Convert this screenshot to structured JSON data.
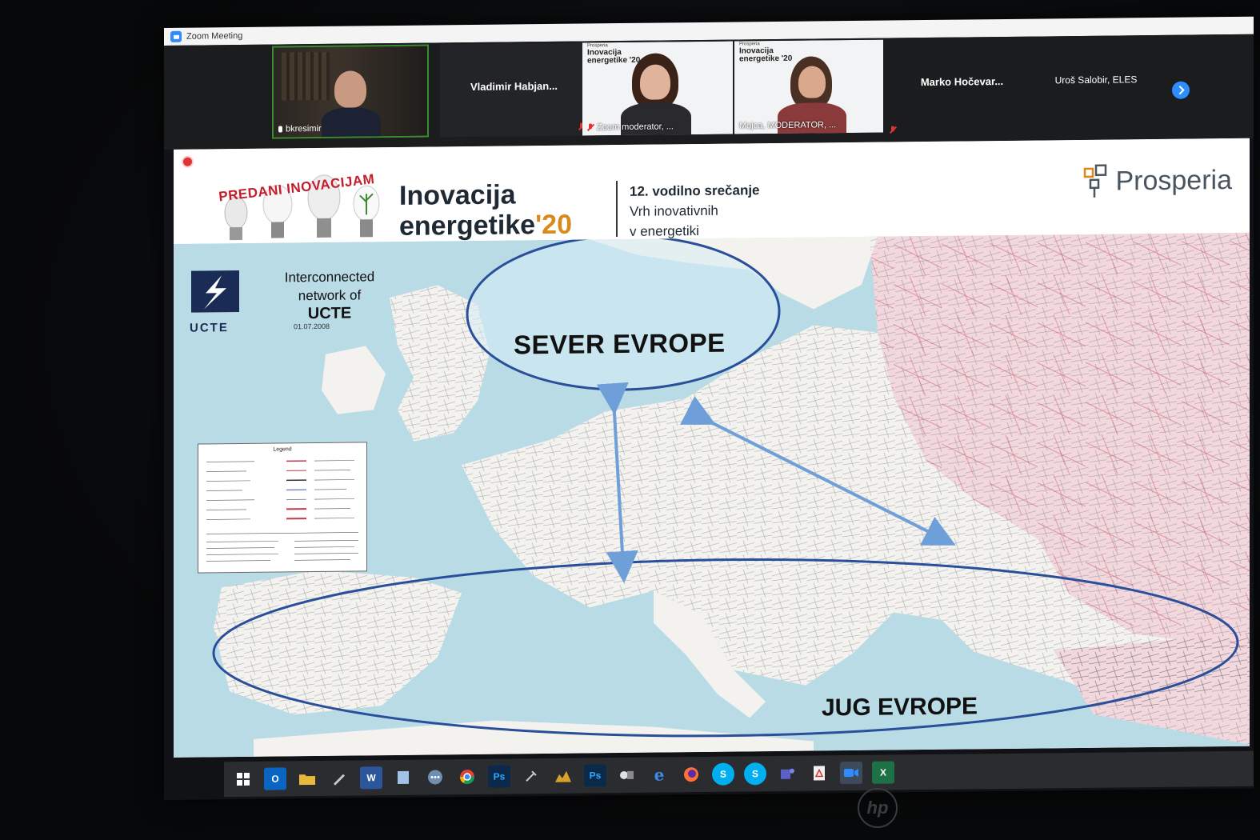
{
  "window": {
    "title": "Zoom Meeting"
  },
  "participants": [
    {
      "name": "bkresimir",
      "muted": false,
      "video": true
    },
    {
      "name": "Vladimir Habjan...",
      "muted": true,
      "video": false
    },
    {
      "name": "Zoom moderator, ...",
      "muted": true,
      "video": true
    },
    {
      "name": "Mojca, MODERATOR, ...",
      "muted": true,
      "video": true
    },
    {
      "name": "Marko Hočevar...",
      "muted": true,
      "video": false
    },
    {
      "name": "Uroš Salobir, ELES",
      "muted": true,
      "video": false
    }
  ],
  "mini_slide": {
    "brand": "Prosperia",
    "title_line1": "Inovacija",
    "title_line2": "energetike '20"
  },
  "slide": {
    "banner": "PREDANI INOVACIJAM",
    "title_line1": "Inovacija",
    "title_line2": "energetike",
    "title_year": "'20",
    "subtitle_line1": "12. vodilno srečanje",
    "subtitle_line2": "Vrh inovativnih",
    "subtitle_line3": "v energetiki",
    "brand": "Prosperia",
    "map": {
      "logo_label": "UCTE",
      "heading_line1": "Interconnected",
      "heading_line2": "network of",
      "heading_line3": "UCTE",
      "date": "01.07.2008",
      "legend_title": "Legend",
      "region_north": "SEVER EVROPE",
      "region_south": "JUG EVROPE"
    }
  },
  "taskbar": {
    "apps": [
      "start-icon",
      "outlook-icon",
      "file-explorer-icon",
      "pen-icon",
      "word-icon",
      "notepad-icon",
      "chat-icon",
      "chrome-icon",
      "photoshop-icon",
      "tool-icon",
      "chart-icon",
      "photoshop-icon",
      "network-icon",
      "edge-icon",
      "firefox-icon",
      "skype-icon",
      "skype-icon",
      "teams-icon",
      "pdf-icon",
      "zoom-icon",
      "excel-icon"
    ],
    "labels": {
      "ps": "Ps",
      "ps2": "Ps",
      "w": "W",
      "x": "X",
      "s": "S",
      "s2": "S",
      "o": "O"
    }
  },
  "colors": {
    "zoom_blue": "#2d8cff",
    "ellipse": "#2a4f9a",
    "arrow": "#6f9fd8",
    "title_accent": "#d98a1c",
    "sea": "#b9dbe6",
    "land_west": "#f4f2ee",
    "land_east": "#f2d7dd"
  }
}
